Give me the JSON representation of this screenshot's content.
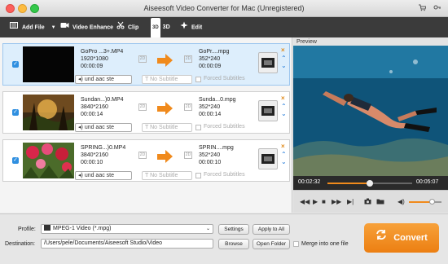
{
  "window": {
    "title": "Aiseesoft Video Converter for Mac (Unregistered)"
  },
  "toolbar": {
    "add_file": "Add File",
    "video_enhance": "Video Enhance",
    "clip": "Clip",
    "three_d_badge": "3D",
    "three_d": "3D",
    "edit": "Edit"
  },
  "files": [
    {
      "name": "GoPro ...3+.MP4",
      "resolution": "1920*1080",
      "duration": "00:00:09",
      "output_name": "GoPr....mpg",
      "output_resolution": "352*240",
      "output_duration": "00:00:09",
      "audio": "und aac ste",
      "subtitle": "No Subtitle",
      "forced_subtitles": "Forced Subtitles",
      "selected": true
    },
    {
      "name": "Sundan...)0.MP4",
      "resolution": "3840*2160",
      "duration": "00:00:14",
      "output_name": "Sunda...0.mpg",
      "output_resolution": "352*240",
      "output_duration": "00:00:14",
      "audio": "und aac ste",
      "subtitle": "No Subtitle",
      "forced_subtitles": "Forced Subtitles",
      "selected": false
    },
    {
      "name": "SPRING...)0.MP4",
      "resolution": "3840*2160",
      "duration": "00:00:10",
      "output_name": "SPRIN....mpg",
      "output_resolution": "352*240",
      "output_duration": "00:00:10",
      "audio": "und aac ste",
      "subtitle": "No Subtitle",
      "forced_subtitles": "Forced Subtitles",
      "selected": false
    }
  ],
  "preview": {
    "label": "Preview",
    "current_time": "00:02:32",
    "total_time": "00:05:07",
    "progress": 0.5,
    "volume": 0.7
  },
  "bottom": {
    "profile_label": "Profile:",
    "profile_value": "MPEG-1 Video (*.mpg)",
    "settings": "Settings",
    "apply_to_all": "Apply to All",
    "destination_label": "Destination:",
    "destination_value": "/Users/pele/Documents/Aiseesoft Studio/Video",
    "browse": "Browse",
    "open_folder": "Open Folder",
    "merge": "Merge into one file",
    "convert": "Convert"
  },
  "colors": {
    "accent": "#f08a1c",
    "toolbar": "#3b3b3b",
    "selection": "#ddeefc"
  }
}
